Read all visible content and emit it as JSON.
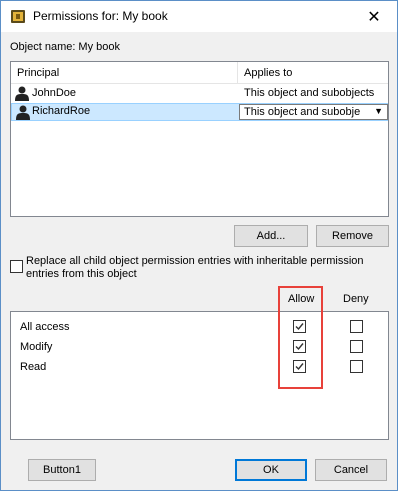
{
  "window": {
    "title": "Permissions for: My book",
    "close_glyph": "✕"
  },
  "object": {
    "label": "Object name:",
    "value": "My book"
  },
  "list": {
    "columns": [
      "Principal",
      "Applies to"
    ],
    "rows": [
      {
        "principal": "JohnDoe",
        "applies_to": "This object and subobjects",
        "selected": false
      },
      {
        "principal": "RichardRoe",
        "applies_to": "This object and subobje",
        "selected": true
      }
    ]
  },
  "buttons": {
    "add": "Add...",
    "remove": "Remove",
    "button1": "Button1",
    "ok": "OK",
    "cancel": "Cancel"
  },
  "replace_option": {
    "label": "Replace all child object permission entries with inheritable permission entries from this object",
    "checked": false
  },
  "permissions": {
    "allow_header": "Allow",
    "deny_header": "Deny",
    "items": [
      {
        "name": "All access",
        "allow": true,
        "deny": false
      },
      {
        "name": "Modify",
        "allow": true,
        "deny": false
      },
      {
        "name": "Read",
        "allow": true,
        "deny": false
      }
    ]
  },
  "colors": {
    "selection": "#cce8ff",
    "highlight_box": "#e8413a",
    "default_button_border": "#0078d7"
  },
  "icons": {
    "title": "lock-icon",
    "user": "user-icon",
    "dropdown": "chevron-down-icon",
    "check": "check-icon"
  }
}
